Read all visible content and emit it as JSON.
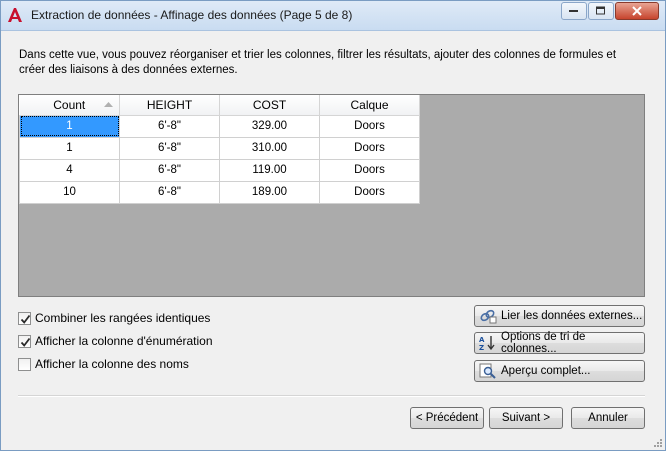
{
  "window": {
    "title": "Extraction de données - Affinage des données (Page 5 de 8)"
  },
  "description": "Dans cette vue, vous pouvez réorganiser et trier les colonnes, filtrer les résultats, ajouter des colonnes de formules et créer des liaisons à des données externes.",
  "grid": {
    "columns": [
      "Count",
      "HEIGHT",
      "COST",
      "Calque"
    ],
    "rows": [
      [
        "1",
        "6'-8\"",
        "329.00",
        "Doors"
      ],
      [
        "1",
        "6'-8\"",
        "310.00",
        "Doors"
      ],
      [
        "4",
        "6'-8\"",
        "119.00",
        "Doors"
      ],
      [
        "10",
        "6'-8\"",
        "189.00",
        "Doors"
      ]
    ]
  },
  "options": {
    "combine_label": "Combiner les rangées identiques",
    "combine_checked": true,
    "enum_label": "Afficher la colonne d'énumération",
    "enum_checked": true,
    "names_label": "Afficher la colonne des noms",
    "names_checked": false
  },
  "side_buttons": {
    "link_label": "Lier les données externes...",
    "sort_label": "Options de tri de colonnes...",
    "preview_label": "Aperçu complet..."
  },
  "footer": {
    "prev_label": "< Précédent",
    "next_label": "Suivant >",
    "cancel_label": "Annuler"
  },
  "colors": {
    "selection": "#3399ff",
    "grid_background": "#ababab",
    "brand_red": "#c8102e"
  }
}
